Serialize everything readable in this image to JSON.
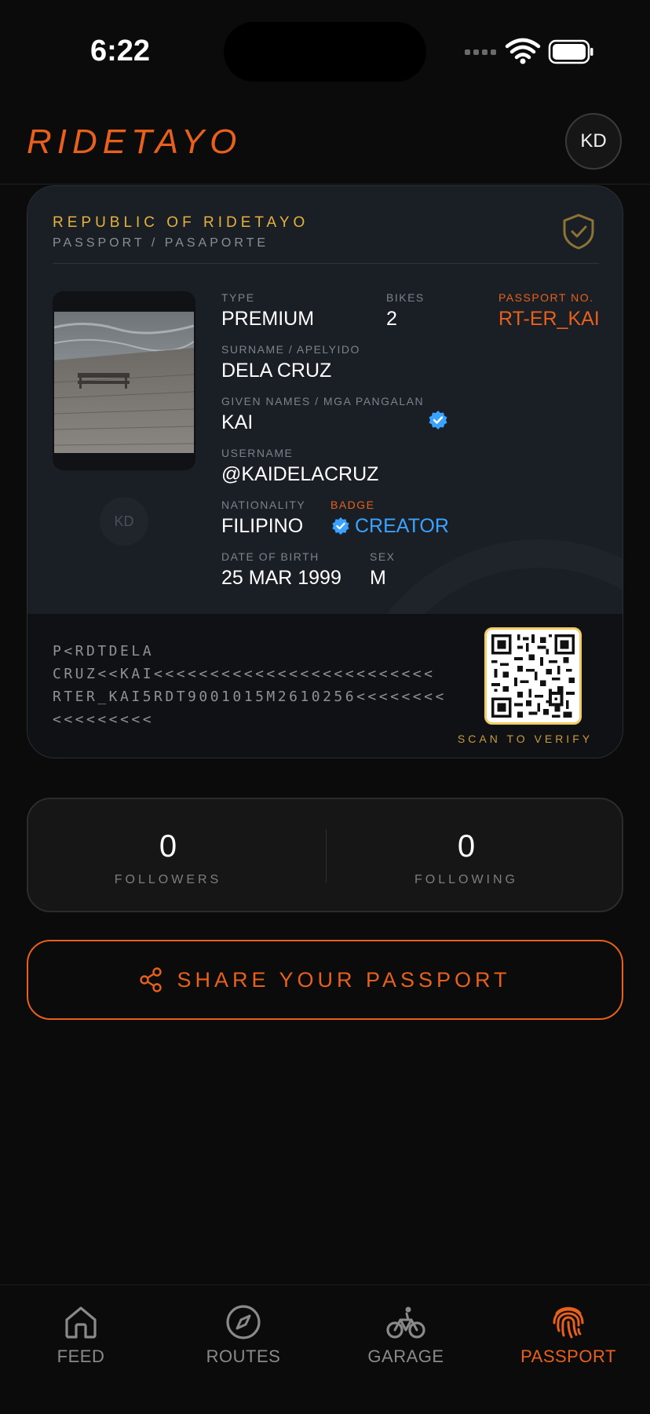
{
  "status": {
    "time": "6:22"
  },
  "header": {
    "brand": "RIDETAYO",
    "avatar_initials": "KD"
  },
  "passport": {
    "republic": "REPUBLIC OF RIDETAYO",
    "subtitle": "PASSPORT / PASAPORTE",
    "seal_initials": "KD",
    "fields": {
      "type_label": "TYPE",
      "type_value": "PREMIUM",
      "bikes_label": "BIKES",
      "bikes_value": "2",
      "passport_no_label": "PASSPORT NO.",
      "passport_no_value": "RT-ER_KAI",
      "surname_label": "SURNAME / APELYIDO",
      "surname_value": "DELA CRUZ",
      "given_label": "GIVEN NAMES / MGA PANGALAN",
      "given_value": "KAI",
      "username_label": "USERNAME",
      "username_value": "@KAIDELACRUZ",
      "nationality_label": "NATIONALITY",
      "nationality_value": "FILIPINO",
      "badge_label": "BADGE",
      "badge_value": "CREATOR",
      "dob_label": "DATE OF BIRTH",
      "dob_value": "25 MAR 1999",
      "sex_label": "SEX",
      "sex_value": "M"
    },
    "mrz": [
      "P<RDTDELA",
      "CRUZ<<KAI<<<<<<<<<<<<<<<<<<<<<<<<<",
      "RTER_KAI5RDT9001015M2610256<<<<<<<<",
      "<<<<<<<<<"
    ],
    "scan_label": "SCAN TO VERIFY"
  },
  "stats": {
    "followers_count": "0",
    "followers_label": "FOLLOWERS",
    "following_count": "0",
    "following_label": "FOLLOWING"
  },
  "share": {
    "label": "SHARE YOUR PASSPORT",
    "icon": "share-icon"
  },
  "tabs": [
    {
      "label": "FEED",
      "icon": "home-icon",
      "active": false
    },
    {
      "label": "ROUTES",
      "icon": "compass-icon",
      "active": false
    },
    {
      "label": "GARAGE",
      "icon": "bicycle-icon",
      "active": false
    },
    {
      "label": "PASSPORT",
      "icon": "fingerprint-icon",
      "active": true
    }
  ],
  "colors": {
    "accent": "#e8601c",
    "gold": "#e6b13c",
    "verified_blue": "#3aa3ff",
    "background": "#0b0b0b",
    "card": "#1a1e25"
  }
}
